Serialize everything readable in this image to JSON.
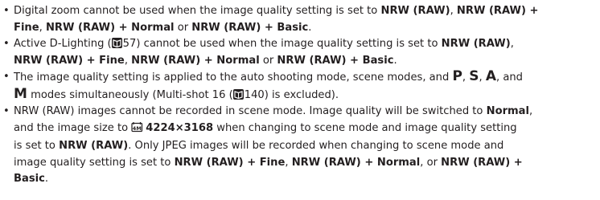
{
  "bullets": [
    {
      "line1": {
        "a": "Digital zoom cannot be used when the image quality setting is set to ",
        "b": "NRW (RAW)",
        "c": ", ",
        "d": "NRW (RAW) +"
      },
      "line2": {
        "a": "Fine",
        "b": ", ",
        "c": "NRW (RAW) + Normal",
        "d": " or ",
        "e": "NRW (RAW) + Basic",
        "f": "."
      }
    },
    {
      "line1": {
        "a": "Active D-Lighting (",
        "ref": "57",
        "b": ") cannot be used when the image quality setting is set to ",
        "c": "NRW (RAW)",
        "d": ","
      },
      "line2": {
        "a": "NRW (RAW) + Fine",
        "b": ", ",
        "c": "NRW (RAW) + Normal",
        "d": " or ",
        "e": "NRW (RAW) + Basic",
        "f": "."
      }
    },
    {
      "line1": {
        "a": "The image quality setting is applied to the auto shooting mode, scene modes, and ",
        "p": "P",
        "c1": ", ",
        "s": "S",
        "c2": ", ",
        "aa": "A",
        "and": ", and"
      },
      "line2": {
        "m": "M",
        "a": " modes simultaneously (Multi-shot 16 (",
        "ref": "140",
        "b": ") is excluded)."
      }
    },
    {
      "line1": {
        "a": "NRW (RAW) images cannot be recorded in scene mode. Image quality will be switched to ",
        "b": "Normal",
        "c": ","
      },
      "line2": {
        "a": "and the image size to ",
        "icon_label": "4M",
        "b": "4224×3168",
        "c": " when changing to scene mode and image quality setting"
      },
      "line3": {
        "a": "is set to ",
        "b": "NRW (RAW)",
        "c": ". Only JPEG images will be recorded when changing to scene mode and"
      },
      "line4": {
        "a": "image quality setting is set to ",
        "b": "NRW (RAW) + Fine",
        "c": ", ",
        "d": "NRW (RAW) + Normal",
        "e": ", or ",
        "f": "NRW (RAW) +"
      },
      "line5": {
        "a": "Basic",
        "b": "."
      }
    }
  ],
  "bullet_symbol": "•",
  "icons": {
    "reference": "book-reference-icon",
    "image_size": "image-size-icon"
  }
}
